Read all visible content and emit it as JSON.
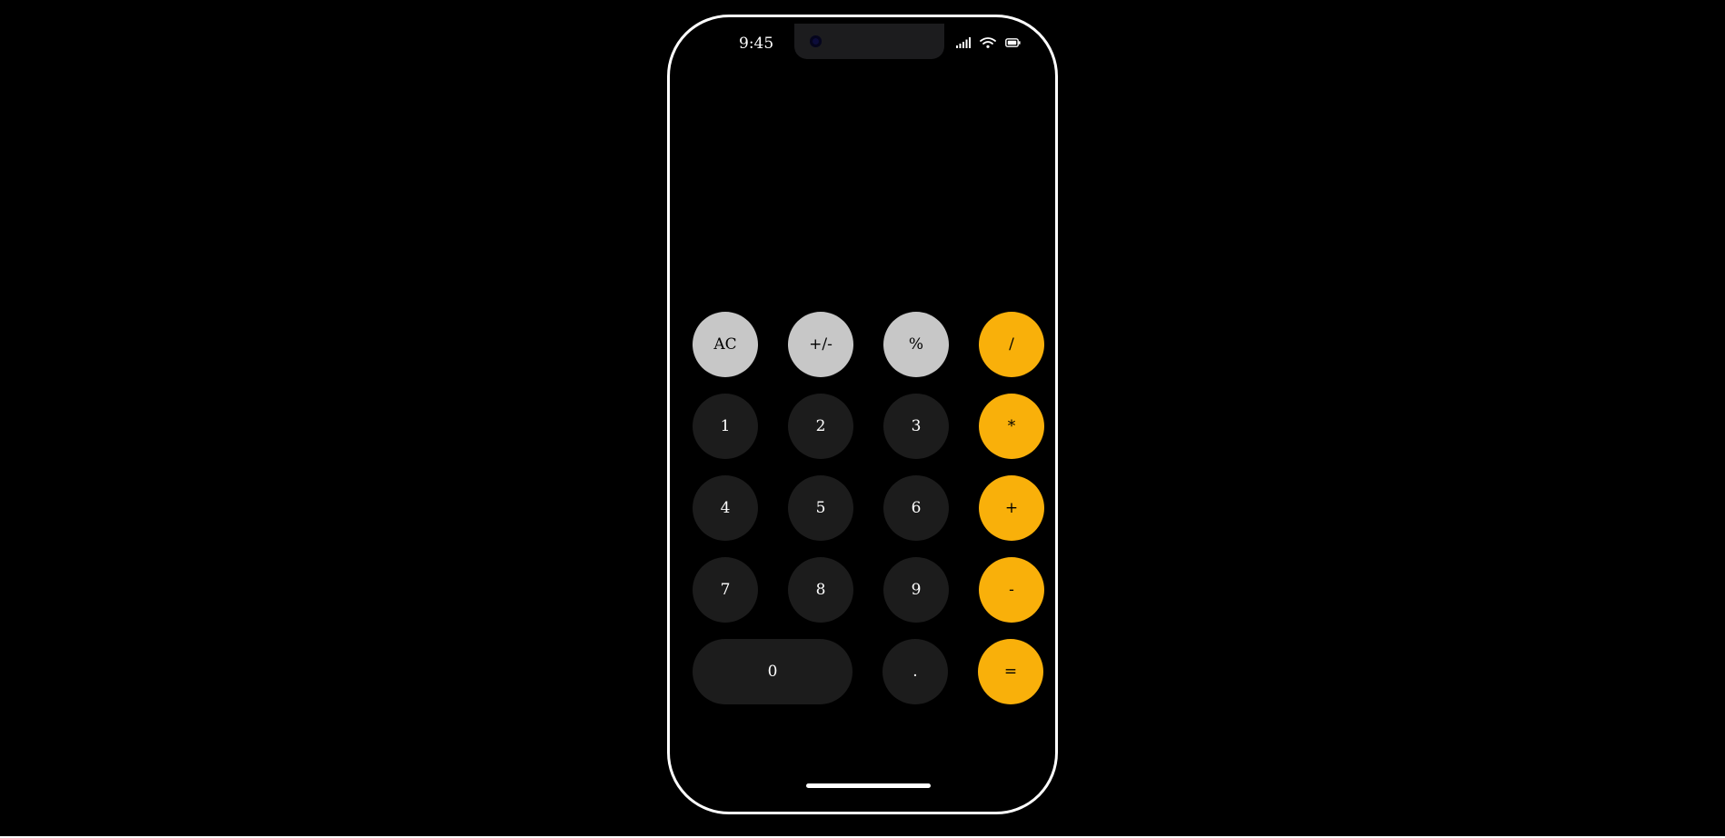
{
  "status_bar": {
    "time": "9:45",
    "icons": [
      "signal-icon",
      "wifi-icon",
      "battery-icon"
    ]
  },
  "display": {
    "value": ""
  },
  "keys": {
    "ac": "AC",
    "sign": "+/-",
    "percent": "%",
    "divide": "/",
    "one": "1",
    "two": "2",
    "three": "3",
    "multiply": "*",
    "four": "4",
    "five": "5",
    "six": "6",
    "add": "+",
    "seven": "7",
    "eight": "8",
    "nine": "9",
    "subtract": "-",
    "zero": "0",
    "decimal": ".",
    "equals": "="
  },
  "colors": {
    "function_key": "#c7c7c7",
    "number_key": "#1c1c1c",
    "operator_key": "#f9b00a",
    "background": "#000000",
    "frame": "#ffffff"
  }
}
